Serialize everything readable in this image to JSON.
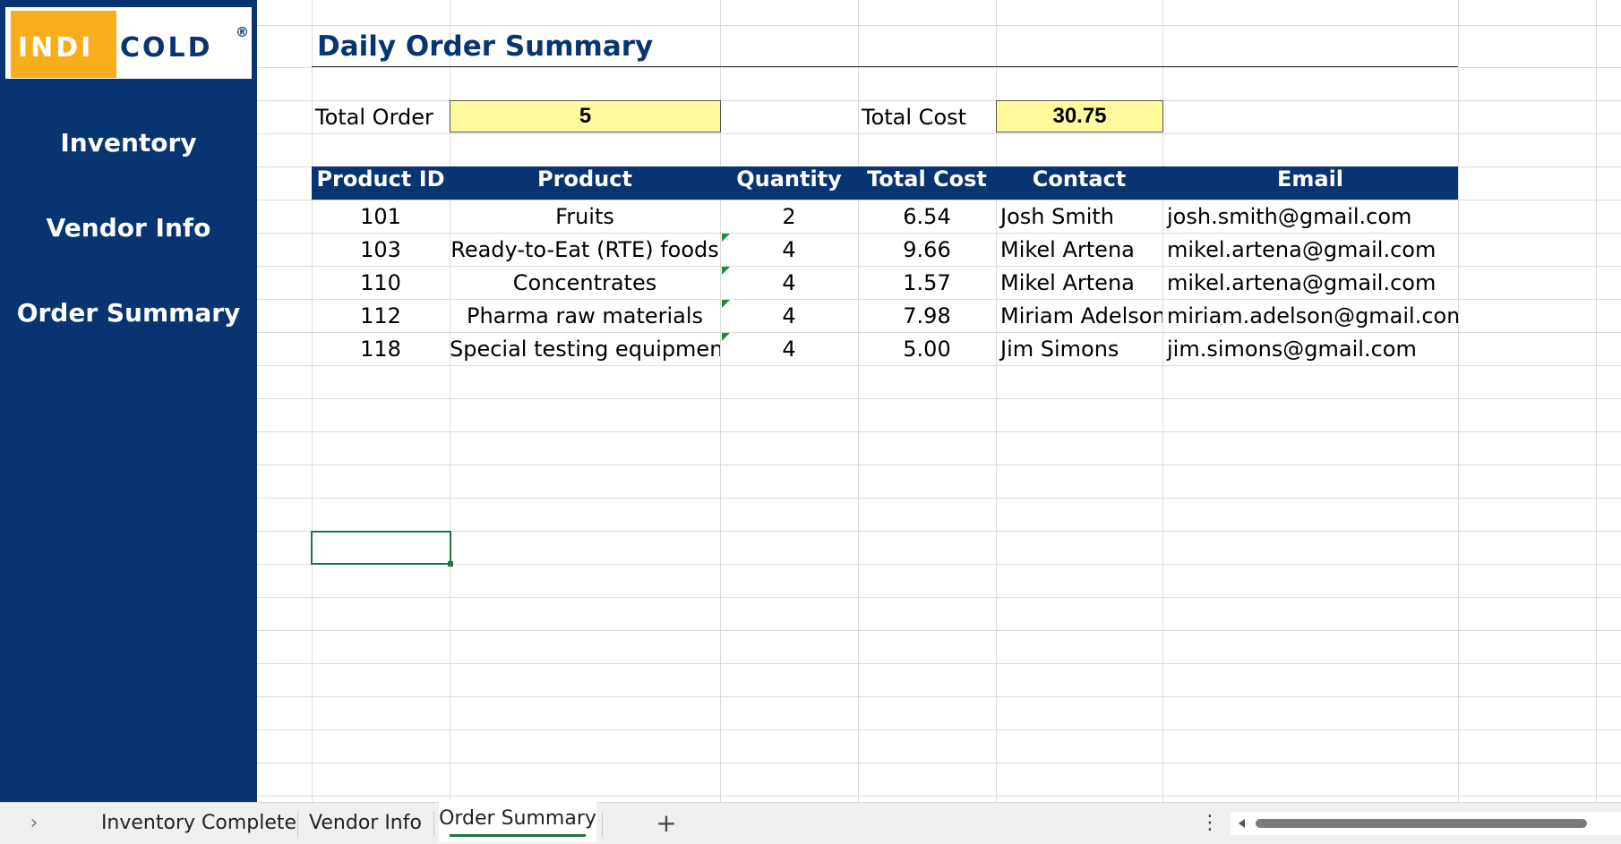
{
  "sidebar": {
    "logo": {
      "part1": "INDI",
      "part2": "COLD",
      "registered": "®"
    },
    "nav": [
      {
        "label": "Inventory"
      },
      {
        "label": "Vendor Info"
      },
      {
        "label": "Order Summary"
      }
    ]
  },
  "report": {
    "title": "Daily Order Summary",
    "total_order_label": "Total Order",
    "total_order_value": "5",
    "total_cost_label": "Total Cost",
    "total_cost_value": "30.75"
  },
  "table": {
    "headers": [
      "Product ID",
      "Product",
      "Quantity",
      "Total Cost",
      "Contact",
      "Email"
    ],
    "rows": [
      [
        "101",
        "Fruits",
        "2",
        "6.54",
        "Josh Smith",
        "josh.smith@gmail.com"
      ],
      [
        "103",
        "Ready-to-Eat (RTE) foods",
        "4",
        "9.66",
        "Mikel Artena",
        "mikel.artena@gmail.com"
      ],
      [
        "110",
        "Concentrates",
        "4",
        "1.57",
        "Mikel Artena",
        "mikel.artena@gmail.com"
      ],
      [
        "112",
        "Pharma raw materials",
        "4",
        "7.98",
        "Miriam Adelson",
        "miriam.adelson@gmail.com"
      ],
      [
        "118",
        "Special testing equipment",
        "4",
        "5.00",
        "Jim Simons",
        "jim.simons@gmail.com"
      ]
    ]
  },
  "sheet_tabs": {
    "items": [
      {
        "label": "Inventory Complete"
      },
      {
        "label": "Vendor Info"
      },
      {
        "label": "Order Summary",
        "active": true
      }
    ],
    "add_label": "+",
    "more_icon": "⋮",
    "prev_icon": "›"
  },
  "colors": {
    "brand_navy": "#083571",
    "brand_orange": "#f8ad1a",
    "highlight_yellow": "#fffa9c",
    "excel_green": "#217346"
  }
}
